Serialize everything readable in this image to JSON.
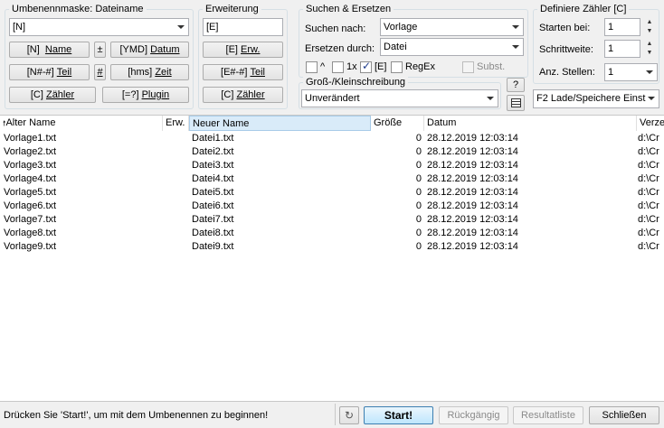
{
  "mask_group": {
    "title": "Umbenennmaske: Dateiname",
    "value": "[N]",
    "buttons": [
      {
        "code": "[N]",
        "label": "Name"
      },
      {
        "code": "±",
        "label": ""
      },
      {
        "code": "[YMD]",
        "label": "Datum"
      },
      {
        "code": "[N#-#]",
        "label": "Teil"
      },
      {
        "code": "#",
        "label": ""
      },
      {
        "code": "[hms]",
        "label": "Zeit"
      },
      {
        "code": "[C]",
        "label": "Zähler"
      },
      {
        "code": "[=?]",
        "label": "Plugin"
      }
    ]
  },
  "ext_group": {
    "title": "Erweiterung",
    "value": "[E]",
    "buttons": [
      {
        "code": "[E]",
        "label": "Erw."
      },
      {
        "code": "[E#-#]",
        "label": "Teil"
      },
      {
        "code": "[C]",
        "label": "Zähler"
      }
    ]
  },
  "search_group": {
    "title": "Suchen & Ersetzen",
    "search_label": "Suchen nach:",
    "search_value": "Vorlage",
    "replace_label": "Ersetzen durch:",
    "replace_value": "Datei",
    "options": [
      {
        "label": "^",
        "checked": false,
        "enabled": true
      },
      {
        "label": "1x",
        "checked": false,
        "enabled": true
      },
      {
        "label": "[E]",
        "checked": true,
        "enabled": true
      },
      {
        "label": "RegEx",
        "checked": false,
        "enabled": true
      },
      {
        "label": "Subst.",
        "checked": false,
        "enabled": false
      }
    ]
  },
  "case_group": {
    "title": "Groß-/Kleinschreibung",
    "value": "Unverändert",
    "help_label": "?"
  },
  "counter_group": {
    "title": "Definiere Zähler [C]",
    "start_label": "Starten bei:",
    "start_value": "1",
    "step_label": "Schrittweite:",
    "step_value": "1",
    "digits_label": "Anz. Stellen:",
    "digits_value": "1"
  },
  "load_save_label": "F2 Lade/Speichere Einst",
  "list": {
    "columns": [
      "Alter Name",
      "Erw.",
      "Neuer Name",
      "Größe",
      "Datum",
      "Verze"
    ],
    "sort_indicator": "🠕",
    "rows": [
      {
        "old": "Vorlage1.txt",
        "new": "Datei1.txt",
        "size": "0",
        "date": "28.12.2019 12:03:14",
        "dir": "d:\\Cr"
      },
      {
        "old": "Vorlage2.txt",
        "new": "Datei2.txt",
        "size": "0",
        "date": "28.12.2019 12:03:14",
        "dir": "d:\\Cr"
      },
      {
        "old": "Vorlage3.txt",
        "new": "Datei3.txt",
        "size": "0",
        "date": "28.12.2019 12:03:14",
        "dir": "d:\\Cr"
      },
      {
        "old": "Vorlage4.txt",
        "new": "Datei4.txt",
        "size": "0",
        "date": "28.12.2019 12:03:14",
        "dir": "d:\\Cr"
      },
      {
        "old": "Vorlage5.txt",
        "new": "Datei5.txt",
        "size": "0",
        "date": "28.12.2019 12:03:14",
        "dir": "d:\\Cr"
      },
      {
        "old": "Vorlage6.txt",
        "new": "Datei6.txt",
        "size": "0",
        "date": "28.12.2019 12:03:14",
        "dir": "d:\\Cr"
      },
      {
        "old": "Vorlage7.txt",
        "new": "Datei7.txt",
        "size": "0",
        "date": "28.12.2019 12:03:14",
        "dir": "d:\\Cr"
      },
      {
        "old": "Vorlage8.txt",
        "new": "Datei8.txt",
        "size": "0",
        "date": "28.12.2019 12:03:14",
        "dir": "d:\\Cr"
      },
      {
        "old": "Vorlage9.txt",
        "new": "Datei9.txt",
        "size": "0",
        "date": "28.12.2019 12:03:14",
        "dir": "d:\\Cr"
      }
    ]
  },
  "footer": {
    "status": "Drücken Sie 'Start!', um mit dem Umbenennen zu beginnen!",
    "start": "Start!",
    "undo": "Rückgängig",
    "results": "Resultatliste",
    "close": "Schließen"
  }
}
